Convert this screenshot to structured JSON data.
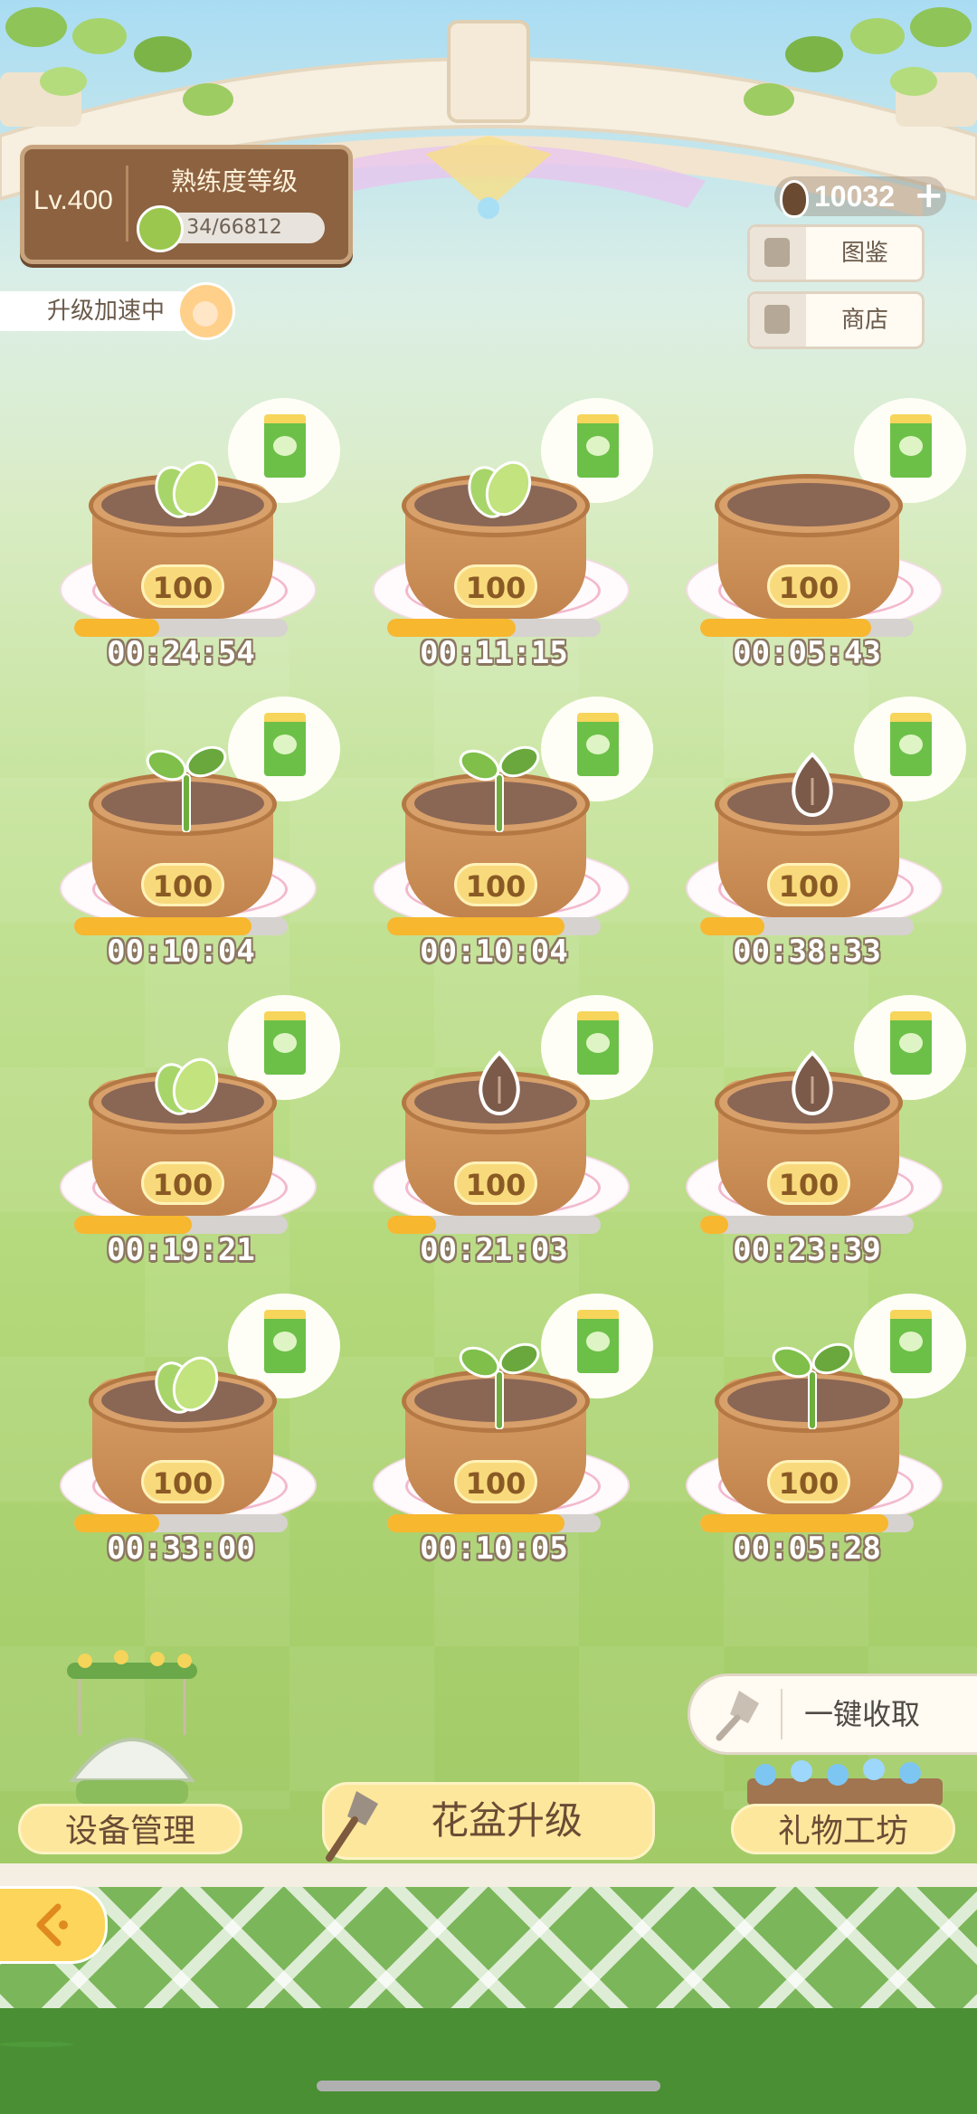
{
  "level": {
    "level_text": "Lv.400",
    "title": "熟练度等级",
    "progress_text": "34/66812",
    "progress_fraction": 0.0005
  },
  "boost_label": "升级加速中",
  "currency": {
    "amount": "10032",
    "plus": "+"
  },
  "side_buttons": [
    {
      "label": "图鉴",
      "icon": "book-icon"
    },
    {
      "label": "商店",
      "icon": "shop-icon"
    }
  ],
  "pots": [
    {
      "level": "100",
      "time": "00:24:54",
      "progress": 0.4,
      "plant": "leaves"
    },
    {
      "level": "100",
      "time": "00:11:15",
      "progress": 0.6,
      "plant": "leaves"
    },
    {
      "level": "100",
      "time": "00:05:43",
      "progress": 0.8,
      "plant": "none"
    },
    {
      "level": "100",
      "time": "00:10:04",
      "progress": 0.83,
      "plant": "sprout"
    },
    {
      "level": "100",
      "time": "00:10:04",
      "progress": 0.83,
      "plant": "sprout"
    },
    {
      "level": "100",
      "time": "00:38:33",
      "progress": 0.3,
      "plant": "seed"
    },
    {
      "level": "100",
      "time": "00:19:21",
      "progress": 0.55,
      "plant": "leaves"
    },
    {
      "level": "100",
      "time": "00:21:03",
      "progress": 0.23,
      "plant": "seed"
    },
    {
      "level": "100",
      "time": "00:23:39",
      "progress": 0.13,
      "plant": "seed"
    },
    {
      "level": "100",
      "time": "00:33:00",
      "progress": 0.4,
      "plant": "leaves"
    },
    {
      "level": "100",
      "time": "00:10:05",
      "progress": 0.83,
      "plant": "sprout"
    },
    {
      "level": "100",
      "time": "00:05:28",
      "progress": 0.88,
      "plant": "sprout"
    }
  ],
  "collect_all": "一键收取",
  "bottom": {
    "device": "设备管理",
    "upgrade": "花盆升级",
    "gift": "礼物工坊"
  },
  "colors": {
    "progress": "#f7b72e",
    "badge": "#f8da7c",
    "panel": "#8c6241"
  }
}
